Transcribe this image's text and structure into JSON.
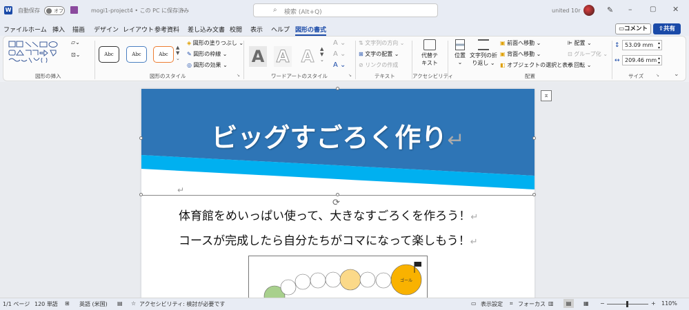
{
  "titlebar": {
    "autosave_label": "自動保存",
    "autosave_state": "オフ",
    "document_name": "mogi1-project4 • この PC に保存済み",
    "search_placeholder": "検索 (Alt+Q)",
    "user_name": "united 10r"
  },
  "menu": {
    "tabs": [
      "ファイル",
      "ホーム",
      "挿入",
      "描画",
      "デザイン",
      "レイアウト",
      "参考資料",
      "差し込み文書",
      "校閲",
      "表示",
      "ヘルプ",
      "図形の書式"
    ],
    "active_tab": "図形の書式",
    "comment_button": "コメント",
    "share_button": "共有"
  },
  "ribbon": {
    "insert_shapes": {
      "label": "図形の挿入"
    },
    "shape_styles": {
      "label": "図形のスタイル",
      "preset": "Abc",
      "fill": "図形の塗りつぶし",
      "outline": "図形の枠線",
      "effects": "図形の効果"
    },
    "wordart": {
      "label": "ワードアートのスタイル",
      "letter": "A"
    },
    "text": {
      "label": "テキスト",
      "direction": "文字列の方向",
      "align": "文字の配置",
      "link": "リンクの作成"
    },
    "accessibility": {
      "label": "アクセシビリティ",
      "alt_text_1": "代替テ",
      "alt_text_2": "キスト"
    },
    "arrange": {
      "label": "配置",
      "position": "位置",
      "wrap_1": "文字列の折",
      "wrap_2": "り返し",
      "bring_forward": "前面へ移動",
      "send_backward": "背面へ移動",
      "selection_pane": "オブジェクトの選択と表示",
      "align": "配置",
      "group": "グループ化",
      "rotate": "回転"
    },
    "size": {
      "label": "サイズ",
      "height": "53.09 mm",
      "width": "209.46 mm"
    }
  },
  "document": {
    "banner_title": "ビッグすごろく作り",
    "line1": "体育館をめいっぱい使って、大きなすごろくを作ろう！",
    "line2": "コースが完成したら自分たちがコマになって楽しもう！",
    "goal_label": "ゴール",
    "paragraph_mark": "↵"
  },
  "statusbar": {
    "page": "1/1 ページ",
    "words": "120 単語",
    "language": "英語 (米国)",
    "accessibility": "アクセシビリティ: 検討が必要です",
    "display_settings": "表示設定",
    "focus": "フォーカス",
    "zoom_minus": "−",
    "zoom_plus": "+",
    "zoom": "110%"
  },
  "colors": {
    "banner_blue": "#2e75b6",
    "banner_cyan": "#00b0f0",
    "accent": "#1a4aa8",
    "circle_yellow": "#fbd989",
    "circle_green": "#a8d08d",
    "goal_orange": "#f9b200"
  }
}
